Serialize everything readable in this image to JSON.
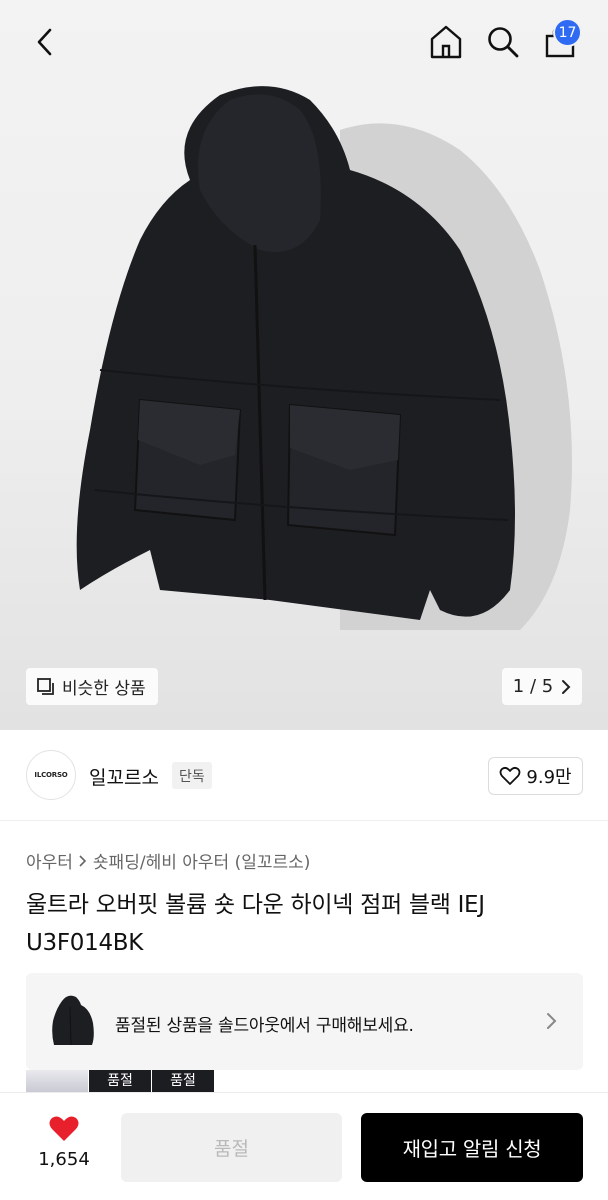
{
  "header": {
    "back_icon": "chevron-left-icon",
    "home_icon": "home-icon",
    "search_icon": "search-icon",
    "cart_icon": "shopping-bag-icon",
    "cart_count": "17",
    "accent_color": "#2f6bf2"
  },
  "gallery": {
    "similar_label": "비슷한 상품",
    "pager_text": "1 / 5"
  },
  "brand": {
    "logo_text": "ILCORSO",
    "name": "일꼬르소",
    "tag": "단독",
    "likes": "9.9만"
  },
  "breadcrumb": {
    "level1": "아우터",
    "level2": "숏패딩/헤비 아우터 (일꼬르소)"
  },
  "product": {
    "title": "울트라 오버핏 볼륨 숏 다운 하이넥 점퍼 블랙 IEJ U3F014BK"
  },
  "soldout_notice": {
    "text": "품절된 상품을 솔드아웃에서 구매해보세요."
  },
  "peek_badges": [
    "품절",
    "품절"
  ],
  "bottom_bar": {
    "wish_count": "1,654",
    "wish_color": "#e8202b",
    "soldout_label": "품절",
    "restock_label": "재입고 알림 신청"
  }
}
